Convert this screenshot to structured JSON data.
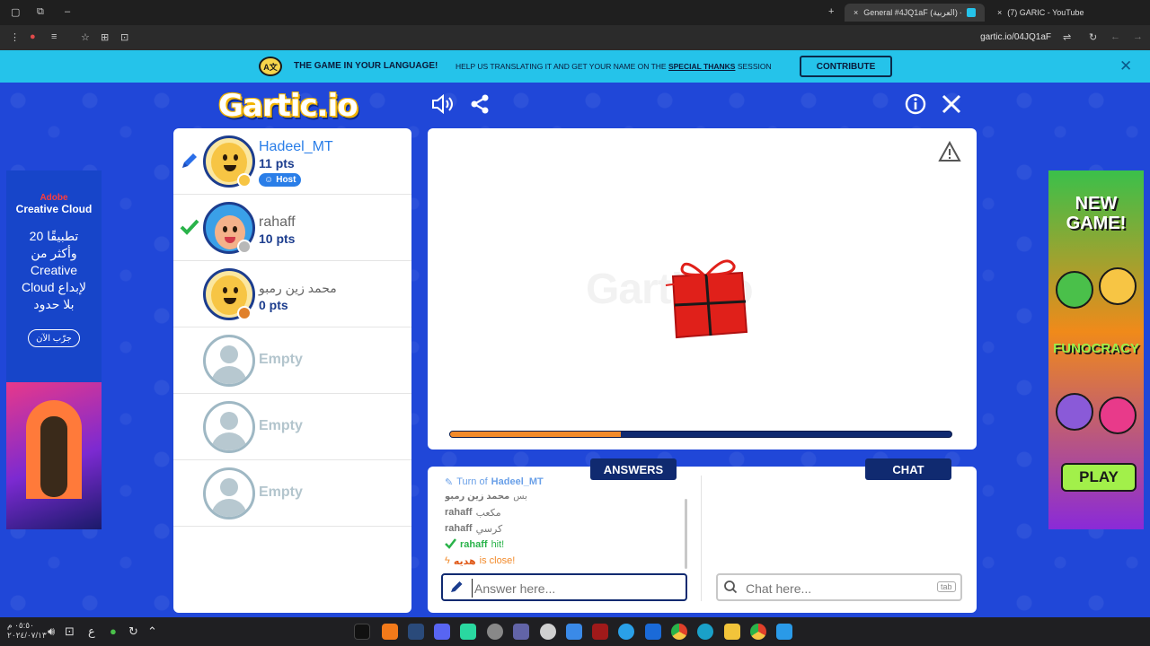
{
  "browser": {
    "tabs": [
      {
        "title": "General #4JQ1aF (العربية) - Gart"
      },
      {
        "title": "(7) GARIC - YouTube"
      }
    ],
    "url": "gartic.io/04JQ1aF",
    "new_tab_glyph": "+",
    "close_tab_glyph": "×"
  },
  "banner": {
    "title": "THE GAME IN YOUR LANGUAGE!",
    "text_before": "HELP US TRANSLATING IT AND GET YOUR NAME ON THE",
    "link": "SPECIAL THANKS",
    "text_after": "SESSION",
    "button": "CONTRIBUTE",
    "lang_icon_text": "A文"
  },
  "logo": "Gartic.io",
  "ad_left": {
    "brand": "Adobe",
    "product": "Creative Cloud",
    "line1": "20 تطبيقًا",
    "line2": "وأكثر من",
    "line3": "Creative",
    "line4": "Cloud لإبداع",
    "line5": "بلا حدود",
    "cta": "جرّب الآن"
  },
  "ad_right": {
    "headline1": "NEW",
    "headline2": "GAME!",
    "brand": "FUNOCRACY",
    "cta": "PLAY"
  },
  "players": [
    {
      "name": "Hadeel_MT",
      "points": "11 pts",
      "badge": "Host",
      "status_color": "#f7c544",
      "name_color": "#2a7ee8"
    },
    {
      "name": "rahaff",
      "points": "10 pts",
      "status_color": "#b8b8b8",
      "name_color": "#666666"
    },
    {
      "name": "محمد زين رمبو",
      "points": "0 pts",
      "status_color": "#e0802a",
      "name_color": "#666666"
    }
  ],
  "empty_slots": [
    "Empty",
    "Empty",
    "Empty"
  ],
  "round": {
    "progress_fraction": 0.34
  },
  "answers": {
    "header": "ANSWERS",
    "feed": [
      {
        "kind": "turn",
        "prefix": "Turn of",
        "user": "Hadeel_MT"
      },
      {
        "kind": "guess",
        "user": "محمد زين رمبو",
        "text": "بس"
      },
      {
        "kind": "guess",
        "user": "rahaff",
        "text": "مكعب"
      },
      {
        "kind": "guess",
        "user": "rahaff",
        "text": "كرسي"
      },
      {
        "kind": "hit",
        "user": "rahaff",
        "text": "hit!"
      },
      {
        "kind": "close",
        "user": "هديه",
        "text": "is close!"
      }
    ],
    "placeholder": "Answer here..."
  },
  "chat": {
    "header": "CHAT",
    "placeholder": "Chat here...",
    "tab_hint": "tab"
  },
  "taskbar": {
    "time": "٠٥:٥٠ م",
    "date": "٢٠٢٤/٠٧/١٣",
    "lang": "ع"
  },
  "colors": {
    "page_bg": "#2047d8",
    "navy": "#102a70",
    "banner": "#25c3ea",
    "accent_orange": "#f28a2a",
    "hit_green": "#2ab34a"
  }
}
